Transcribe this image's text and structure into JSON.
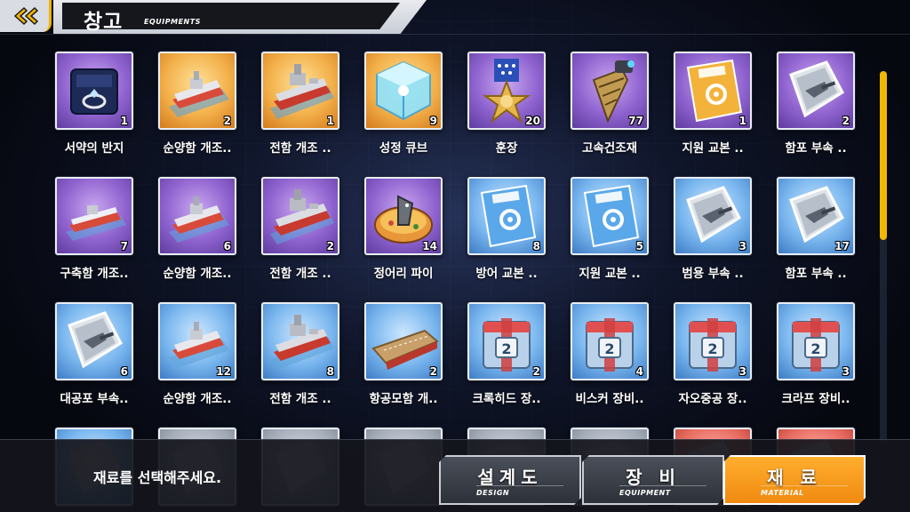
{
  "header": {
    "title": "창고",
    "subtitle": "EQUIPMENTS",
    "back_icon": "double-chevron-left-icon"
  },
  "items": [
    {
      "name": "서약의 반지",
      "qty": "1",
      "color": "purple",
      "icon": "ring-box-icon"
    },
    {
      "name": "순양함 개조..",
      "qty": "2",
      "color": "orange",
      "icon": "cruiser-blueprint-icon"
    },
    {
      "name": "전함 개조 ..",
      "qty": "1",
      "color": "orange",
      "icon": "battleship-blueprint-icon"
    },
    {
      "name": "성정 큐브",
      "qty": "9",
      "color": "orange",
      "icon": "cube-icon"
    },
    {
      "name": "훈장",
      "qty": "20",
      "color": "purple",
      "icon": "medal-icon"
    },
    {
      "name": "고속건조재",
      "qty": "77",
      "color": "purple",
      "icon": "drill-icon"
    },
    {
      "name": "지원 교본 ..",
      "qty": "1",
      "color": "purple",
      "icon": "skill-book-icon"
    },
    {
      "name": "함포 부속 ..",
      "qty": "2",
      "color": "purple",
      "icon": "gun-part-icon"
    },
    {
      "name": "구축함 개조..",
      "qty": "7",
      "color": "purple",
      "icon": "destroyer-blueprint-icon"
    },
    {
      "name": "순양함 개조..",
      "qty": "6",
      "color": "purple",
      "icon": "cruiser-blueprint-icon"
    },
    {
      "name": "전함 개조 ..",
      "qty": "2",
      "color": "purple",
      "icon": "battleship-blueprint-icon"
    },
    {
      "name": "정어리 파이",
      "qty": "14",
      "color": "purple",
      "icon": "fish-pie-icon"
    },
    {
      "name": "방어 교본 ..",
      "qty": "8",
      "color": "blue",
      "icon": "skill-book-icon"
    },
    {
      "name": "지원 교본 ..",
      "qty": "5",
      "color": "blue",
      "icon": "skill-book-icon"
    },
    {
      "name": "범용 부속 ..",
      "qty": "3",
      "color": "blue",
      "icon": "gun-part-icon"
    },
    {
      "name": "함포 부속 ..",
      "qty": "17",
      "color": "blue",
      "icon": "gun-part-icon"
    },
    {
      "name": "대공포 부속..",
      "qty": "6",
      "color": "blue",
      "icon": "gun-part-icon"
    },
    {
      "name": "순양함 개조..",
      "qty": "12",
      "color": "blue",
      "icon": "cruiser-blueprint-icon"
    },
    {
      "name": "전함 개조 ..",
      "qty": "8",
      "color": "blue",
      "icon": "battleship-blueprint-icon"
    },
    {
      "name": "항공모함 개..",
      "qty": "2",
      "color": "blue",
      "icon": "carrier-blueprint-icon"
    },
    {
      "name": "크록히드 장..",
      "qty": "2",
      "color": "blue",
      "icon": "tech-box-icon"
    },
    {
      "name": "비스커 장비..",
      "qty": "4",
      "color": "blue",
      "icon": "tech-box-icon"
    },
    {
      "name": "자오중공 장..",
      "qty": "3",
      "color": "blue",
      "icon": "tech-box-icon"
    },
    {
      "name": "크라프 장비..",
      "qty": "3",
      "color": "blue",
      "icon": "tech-box-icon"
    },
    {
      "name": "",
      "qty": "",
      "color": "blue",
      "icon": "partial-item-icon"
    },
    {
      "name": "",
      "qty": "",
      "color": "grey",
      "icon": "partial-item-icon"
    },
    {
      "name": "",
      "qty": "",
      "color": "grey",
      "icon": "partial-item-icon"
    },
    {
      "name": "",
      "qty": "",
      "color": "grey",
      "icon": "partial-item-icon"
    },
    {
      "name": "",
      "qty": "",
      "color": "grey",
      "icon": "partial-item-icon"
    },
    {
      "name": "",
      "qty": "",
      "color": "grey",
      "icon": "partial-item-icon"
    },
    {
      "name": "",
      "qty": "",
      "color": "red",
      "icon": "partial-item-icon"
    },
    {
      "name": "",
      "qty": "",
      "color": "red",
      "icon": "partial-item-icon"
    }
  ],
  "status_text": "재료를 선택해주세요.",
  "tabs": [
    {
      "label": "설계도",
      "sublabel": "DESIGN",
      "active": false
    },
    {
      "label": "장 비",
      "sublabel": "EQUIPMENT",
      "active": false
    },
    {
      "label": "재 료",
      "sublabel": "MATERIAL",
      "active": true
    }
  ],
  "colors": {
    "accent": "#f2b705",
    "active_tab": "#f08a10"
  }
}
